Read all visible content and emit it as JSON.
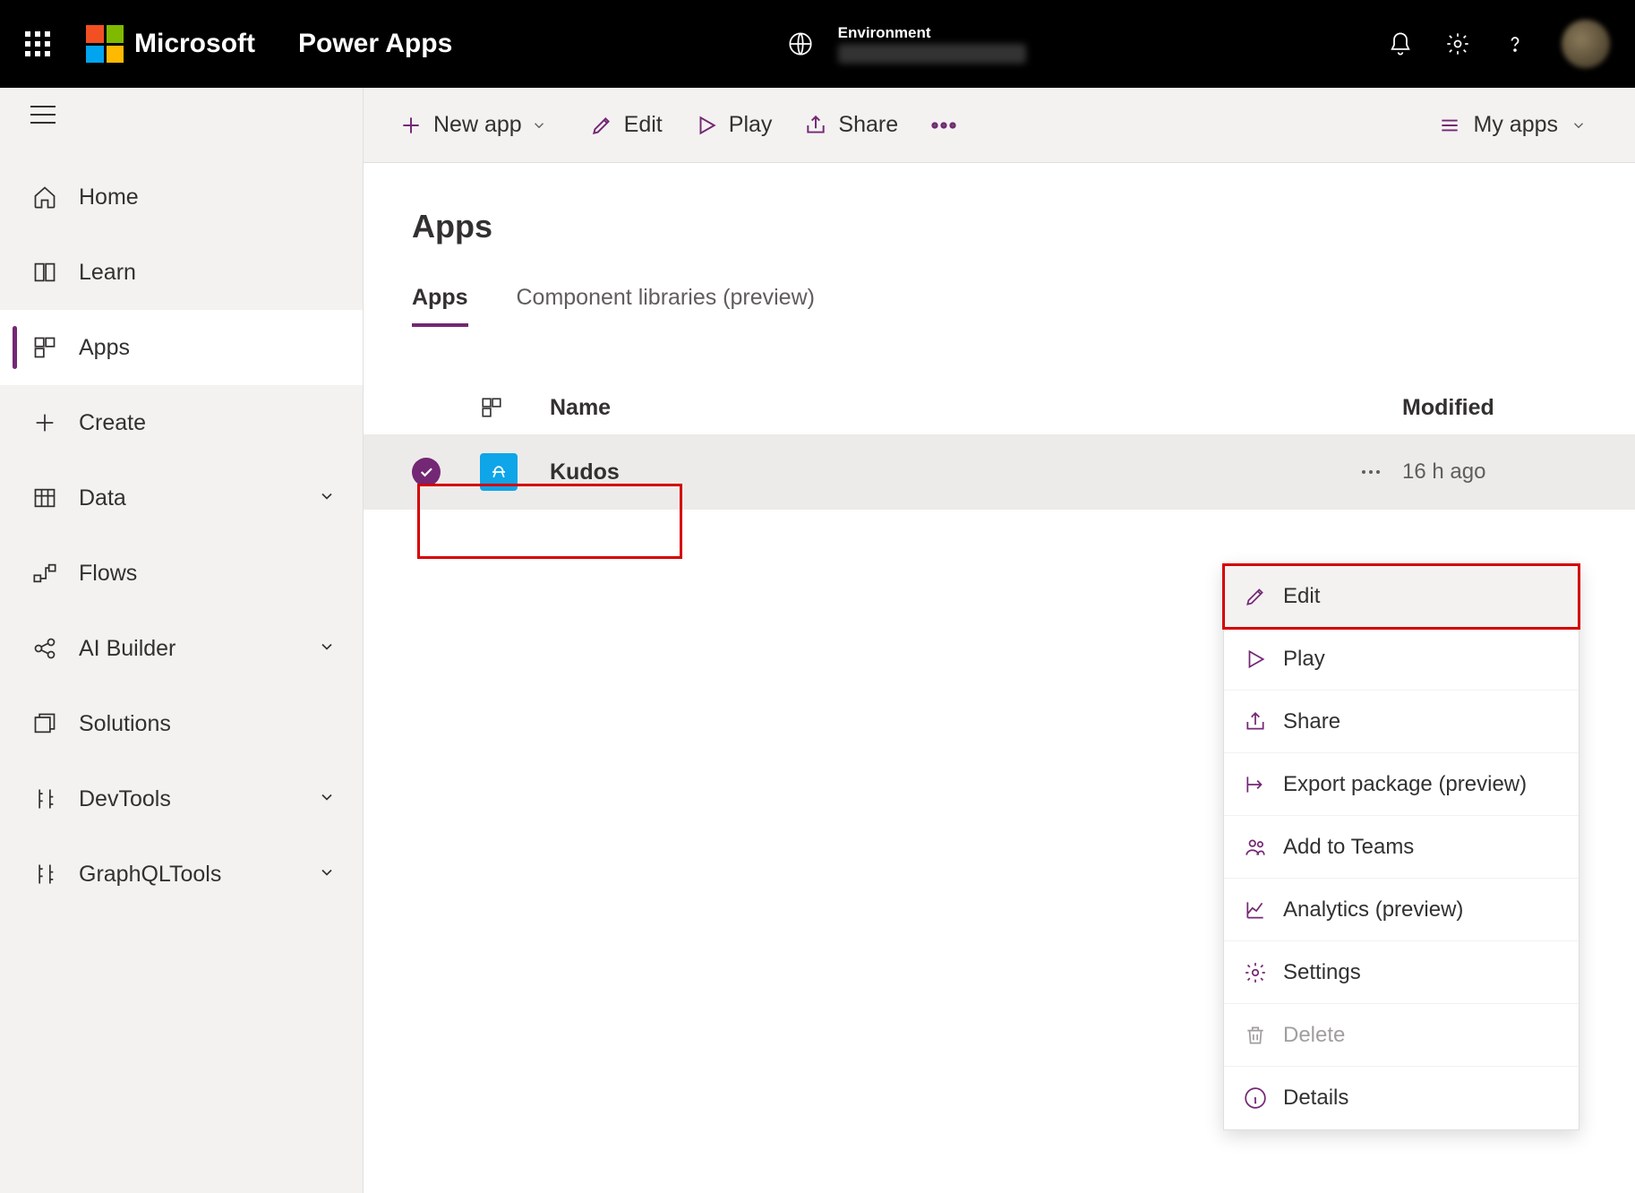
{
  "header": {
    "brand": "Microsoft",
    "product": "Power Apps",
    "environment_label": "Environment"
  },
  "sidebar": {
    "items": [
      {
        "label": "Home"
      },
      {
        "label": "Learn"
      },
      {
        "label": "Apps"
      },
      {
        "label": "Create"
      },
      {
        "label": "Data"
      },
      {
        "label": "Flows"
      },
      {
        "label": "AI Builder"
      },
      {
        "label": "Solutions"
      },
      {
        "label": "DevTools"
      },
      {
        "label": "GraphQLTools"
      }
    ]
  },
  "cmdbar": {
    "new_app": "New app",
    "edit": "Edit",
    "play": "Play",
    "share": "Share",
    "view": "My apps"
  },
  "page": {
    "title": "Apps",
    "tabs": {
      "apps": "Apps",
      "libs": "Component libraries (preview)"
    },
    "columns": {
      "name": "Name",
      "modified": "Modified"
    }
  },
  "row": {
    "name": "Kudos",
    "modified": "16 h ago"
  },
  "ctx": {
    "edit": "Edit",
    "play": "Play",
    "share": "Share",
    "export": "Export package (preview)",
    "teams": "Add to Teams",
    "analytics": "Analytics (preview)",
    "settings": "Settings",
    "delete": "Delete",
    "details": "Details"
  }
}
